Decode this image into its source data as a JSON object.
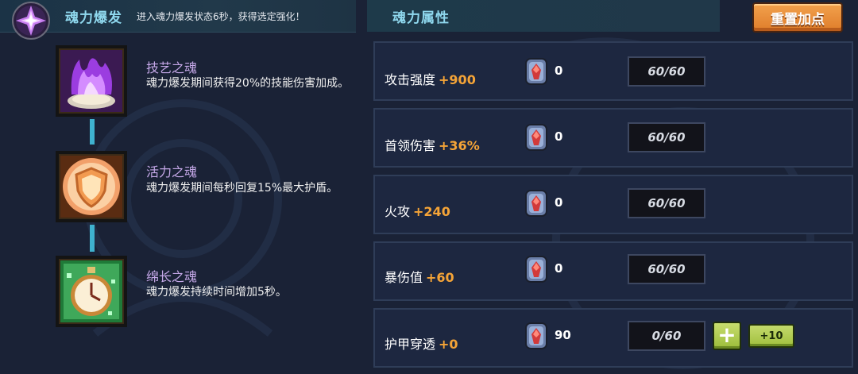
{
  "left": {
    "title": "魂力爆发",
    "description": "进入魂力爆发状态6秒，获得选定强化！",
    "souls": [
      {
        "name": "技艺之魂",
        "description": "魂力爆发期间获得20%的技能伤害加成。",
        "icon": "purple-flame-icon"
      },
      {
        "name": "活力之魂",
        "description": "魂力爆发期间每秒回复15%最大护盾。",
        "icon": "shield-medallion-icon"
      },
      {
        "name": "绵长之魂",
        "description": "魂力爆发持续时间增加5秒。",
        "icon": "stopwatch-icon"
      }
    ]
  },
  "right": {
    "title": "魂力属性",
    "reset_label": "重置加点",
    "attributes": [
      {
        "name": "攻击强度",
        "bonus": "+900",
        "count": "0",
        "cap": "60/60"
      },
      {
        "name": "首领伤害",
        "bonus": "+36%",
        "count": "0",
        "cap": "60/60"
      },
      {
        "name": "火攻",
        "bonus": "+240",
        "count": "0",
        "cap": "60/60"
      },
      {
        "name": "暴伤值",
        "bonus": "+60",
        "count": "0",
        "cap": "60/60"
      },
      {
        "name": "护甲穿透",
        "bonus": "+0",
        "count": "90",
        "cap": "0/60",
        "add_label": "+",
        "add10_label": "+10"
      }
    ]
  },
  "colors": {
    "accent_cyan": "#8fd8ee",
    "bonus_orange": "#f5a437",
    "soul_name_lavender": "#c5a8e8",
    "reset_orange": "#e8883a",
    "add_green": "#a8c84a"
  }
}
